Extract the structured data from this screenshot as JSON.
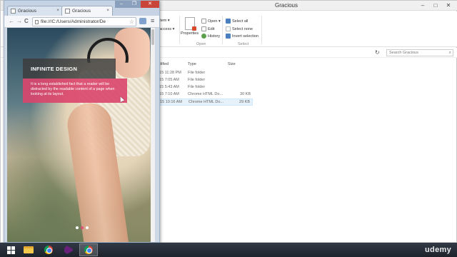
{
  "explorer": {
    "title": "Gracious",
    "controls": [
      "–",
      "□",
      "✕"
    ],
    "help": "?",
    "ribbon": {
      "new_item": "item ▾",
      "easy_access": "access ▾",
      "properties": "Properties",
      "open": "Open ▾",
      "edit": "Edit",
      "history": "History",
      "open_group": "Open",
      "select_all": "Select all",
      "select_none": "Select none",
      "invert_selection": "Invert selection",
      "select_group": "Select"
    },
    "search_placeholder": "Search Gracious",
    "columns": {
      "modified": "odified",
      "type": "Type",
      "size": "Size"
    },
    "rows": [
      {
        "date": "015 11:28 PM",
        "type": "File folder",
        "size": ""
      },
      {
        "date": "015 7:05 AM",
        "type": "File folder",
        "size": ""
      },
      {
        "date": "015 5:43 AM",
        "type": "File folder",
        "size": ""
      },
      {
        "date": "015 7:10 AM",
        "type": "Chrome HTML Do...",
        "size": "30 KB"
      },
      {
        "date": "015 10:16 AM",
        "type": "Chrome HTML Do...",
        "size": "29 KB"
      }
    ]
  },
  "chrome": {
    "tabs": [
      {
        "label": "Gracious",
        "close": "×"
      },
      {
        "label": "Gracious",
        "close": "×"
      }
    ],
    "address": "file:///C:/Users/Administrator/De",
    "back": "←",
    "forward": "→",
    "reload": "C",
    "star": "☆",
    "menu": "≡"
  },
  "page": {
    "heading": "INFINITE DESIGN",
    "body_text": "It is a long established fact that a reader will be distracted by the readable content of a page when looking at its layout.",
    "active_slide": 2,
    "slide_count": 3
  },
  "taskbar": {
    "brand": "udemy"
  }
}
